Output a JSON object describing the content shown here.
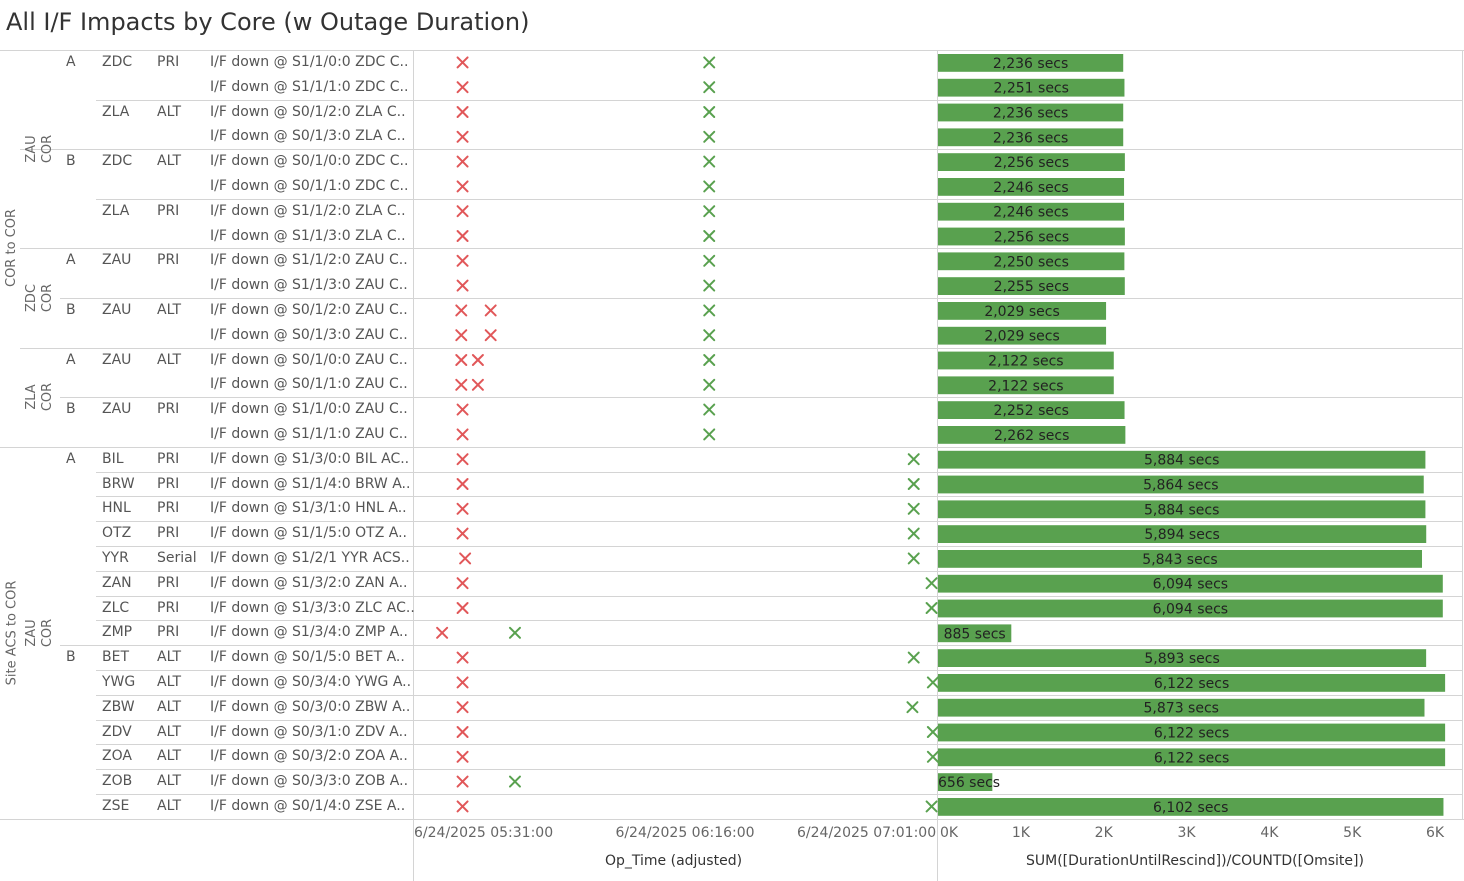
{
  "title": "All I/F Impacts by Core (w Outage Duration)",
  "colors": {
    "down": "#e15759",
    "up": "#59a14f",
    "bar": "#59a14f",
    "grid": "#d4d4d4"
  },
  "icons": {
    "down_mark": "x-mark-icon",
    "up_mark": "x-mark-icon"
  },
  "groups": [
    {
      "label": "COR to COR",
      "cores": [
        {
          "label": [
            "ZAU",
            "COR"
          ],
          "sides": [
            "A",
            "B"
          ]
        },
        {
          "label": [
            "ZDC",
            "COR"
          ],
          "sides": [
            "A",
            "B"
          ]
        },
        {
          "label": [
            "ZLA",
            "COR"
          ],
          "sides": [
            "A",
            "B"
          ]
        }
      ]
    },
    {
      "label": "Site ACS to COR",
      "cores": [
        {
          "label": [
            "ZAU",
            "COR"
          ],
          "sides": [
            "A",
            "B"
          ]
        }
      ]
    }
  ],
  "rows": [
    {
      "side": "A",
      "site": "ZDC",
      "role": "PRI",
      "desc": "I/F down @ S1/1/0:0 ZDC C..",
      "down": [
        "05:32:30"
      ],
      "up": [
        "06:20:45"
      ],
      "duration": 2236,
      "label": "2,236 secs"
    },
    {
      "side": "",
      "site": "",
      "role": "",
      "desc": "I/F down @ S1/1/1:0 ZDC C..",
      "down": [
        "05:32:30"
      ],
      "up": [
        "06:20:45"
      ],
      "duration": 2251,
      "label": "2,251 secs"
    },
    {
      "side": "",
      "site": "ZLA",
      "role": "ALT",
      "desc": "I/F down @ S0/1/2:0 ZLA C..",
      "down": [
        "05:32:30"
      ],
      "up": [
        "06:20:45"
      ],
      "duration": 2236,
      "label": "2,236 secs"
    },
    {
      "side": "",
      "site": "",
      "role": "",
      "desc": "I/F down @ S0/1/3:0 ZLA C..",
      "down": [
        "05:32:30"
      ],
      "up": [
        "06:20:45"
      ],
      "duration": 2236,
      "label": "2,236 secs"
    },
    {
      "side": "B",
      "site": "ZDC",
      "role": "ALT",
      "desc": "I/F down @ S0/1/0:0 ZDC C..",
      "down": [
        "05:32:30"
      ],
      "up": [
        "06:20:45"
      ],
      "duration": 2256,
      "label": "2,256 secs"
    },
    {
      "side": "",
      "site": "",
      "role": "",
      "desc": "I/F down @ S0/1/1:0 ZDC C..",
      "down": [
        "05:32:30"
      ],
      "up": [
        "06:20:45"
      ],
      "duration": 2246,
      "label": "2,246 secs"
    },
    {
      "side": "",
      "site": "ZLA",
      "role": "PRI",
      "desc": "I/F down @ S1/1/2:0 ZLA C..",
      "down": [
        "05:32:30"
      ],
      "up": [
        "06:20:45"
      ],
      "duration": 2246,
      "label": "2,246 secs"
    },
    {
      "side": "",
      "site": "",
      "role": "",
      "desc": "I/F down @ S1/1/3:0 ZLA C..",
      "down": [
        "05:32:30"
      ],
      "up": [
        "06:20:45"
      ],
      "duration": 2256,
      "label": "2,256 secs"
    },
    {
      "side": "A",
      "site": "ZAU",
      "role": "PRI",
      "desc": "I/F down @ S1/1/2:0 ZAU C..",
      "down": [
        "05:32:30"
      ],
      "up": [
        "06:20:45"
      ],
      "duration": 2250,
      "label": "2,250 secs"
    },
    {
      "side": "",
      "site": "",
      "role": "",
      "desc": "I/F down @ S1/1/3:0 ZAU C..",
      "down": [
        "05:32:30"
      ],
      "up": [
        "06:20:45"
      ],
      "duration": 2255,
      "label": "2,255 secs"
    },
    {
      "side": "B",
      "site": "ZAU",
      "role": "ALT",
      "desc": "I/F down @ S0/1/2:0 ZAU C..",
      "down": [
        "05:32:15",
        "05:38:00"
      ],
      "up": [
        "06:20:45"
      ],
      "duration": 2029,
      "label": "2,029 secs"
    },
    {
      "side": "",
      "site": "",
      "role": "",
      "desc": "I/F down @ S0/1/3:0 ZAU C..",
      "down": [
        "05:32:15",
        "05:38:00"
      ],
      "up": [
        "06:20:45"
      ],
      "duration": 2029,
      "label": "2,029 secs"
    },
    {
      "side": "A",
      "site": "ZAU",
      "role": "ALT",
      "desc": "I/F down @ S0/1/0:0 ZAU C..",
      "down": [
        "05:32:15",
        "05:35:30"
      ],
      "up": [
        "06:20:45"
      ],
      "duration": 2122,
      "label": "2,122 secs"
    },
    {
      "side": "",
      "site": "",
      "role": "",
      "desc": "I/F down @ S0/1/1:0 ZAU C..",
      "down": [
        "05:32:15",
        "05:35:30"
      ],
      "up": [
        "06:20:45"
      ],
      "duration": 2122,
      "label": "2,122 secs"
    },
    {
      "side": "B",
      "site": "ZAU",
      "role": "PRI",
      "desc": "I/F down @ S1/1/0:0 ZAU C..",
      "down": [
        "05:32:30"
      ],
      "up": [
        "06:20:45"
      ],
      "duration": 2252,
      "label": "2,252 secs"
    },
    {
      "side": "",
      "site": "",
      "role": "",
      "desc": "I/F down @ S1/1/1:0 ZAU C..",
      "down": [
        "05:32:30"
      ],
      "up": [
        "06:20:45"
      ],
      "duration": 2262,
      "label": "2,262 secs"
    },
    {
      "side": "A",
      "site": "BIL",
      "role": "PRI",
      "desc": "I/F down @ S1/3/0:0 BIL AC..",
      "down": [
        "05:32:30"
      ],
      "up": [
        "07:00:45"
      ],
      "duration": 5884,
      "label": "5,884 secs"
    },
    {
      "side": "",
      "site": "BRW",
      "role": "PRI",
      "desc": "I/F down @ S1/1/4:0 BRW A..",
      "down": [
        "05:32:30"
      ],
      "up": [
        "07:00:45"
      ],
      "duration": 5864,
      "label": "5,864 secs"
    },
    {
      "side": "",
      "site": "HNL",
      "role": "PRI",
      "desc": "I/F down @ S1/3/1:0 HNL A..",
      "down": [
        "05:32:30"
      ],
      "up": [
        "07:00:45"
      ],
      "duration": 5884,
      "label": "5,884 secs"
    },
    {
      "side": "",
      "site": "OTZ",
      "role": "PRI",
      "desc": "I/F down @ S1/1/5:0 OTZ A..",
      "down": [
        "05:32:30"
      ],
      "up": [
        "07:00:45"
      ],
      "duration": 5894,
      "label": "5,894 secs"
    },
    {
      "side": "",
      "site": "YYR",
      "role": "Serial",
      "desc": "I/F down @ S1/2/1 YYR ACS..",
      "down": [
        "05:33:00"
      ],
      "up": [
        "07:00:45"
      ],
      "duration": 5843,
      "label": "5,843 secs"
    },
    {
      "side": "",
      "site": "ZAN",
      "role": "PRI",
      "desc": "I/F down @ S1/3/2:0 ZAN A..",
      "down": [
        "05:32:30"
      ],
      "up": [
        "07:04:15"
      ],
      "duration": 6094,
      "label": "6,094 secs"
    },
    {
      "side": "",
      "site": "ZLC",
      "role": "PRI",
      "desc": "I/F down @ S1/3/3:0 ZLC AC..",
      "down": [
        "05:32:30"
      ],
      "up": [
        "07:04:15"
      ],
      "duration": 6094,
      "label": "6,094 secs"
    },
    {
      "side": "",
      "site": "ZMP",
      "role": "PRI",
      "desc": "I/F down @ S1/3/4:0 ZMP A..",
      "down": [
        "05:28:30"
      ],
      "up": [
        "05:42:45"
      ],
      "duration": 885,
      "label": "885 secs"
    },
    {
      "side": "B",
      "site": "BET",
      "role": "ALT",
      "desc": "I/F down @ S0/1/5:0 BET A..",
      "down": [
        "05:32:30"
      ],
      "up": [
        "07:00:45"
      ],
      "duration": 5893,
      "label": "5,893 secs"
    },
    {
      "side": "",
      "site": "YWG",
      "role": "ALT",
      "desc": "I/F down @ S0/3/4:0 YWG A..",
      "down": [
        "05:32:30"
      ],
      "up": [
        "07:04:30"
      ],
      "duration": 6122,
      "label": "6,122 secs"
    },
    {
      "side": "",
      "site": "ZBW",
      "role": "ALT",
      "desc": "I/F down @ S0/3/0:0 ZBW A..",
      "down": [
        "05:32:30"
      ],
      "up": [
        "07:00:30"
      ],
      "duration": 5873,
      "label": "5,873 secs"
    },
    {
      "side": "",
      "site": "ZDV",
      "role": "ALT",
      "desc": "I/F down @ S0/3/1:0 ZDV A..",
      "down": [
        "05:32:30"
      ],
      "up": [
        "07:04:30"
      ],
      "duration": 6122,
      "label": "6,122 secs"
    },
    {
      "side": "",
      "site": "ZOA",
      "role": "ALT",
      "desc": "I/F down @ S0/3/2:0 ZOA A..",
      "down": [
        "05:32:30"
      ],
      "up": [
        "07:04:30"
      ],
      "duration": 6122,
      "label": "6,122 secs"
    },
    {
      "side": "",
      "site": "ZOB",
      "role": "ALT",
      "desc": "I/F down @ S0/3/3:0 ZOB A..",
      "down": [
        "05:32:30"
      ],
      "up": [
        "05:42:45"
      ],
      "duration": 656,
      "label": "656 secs"
    },
    {
      "side": "",
      "site": "ZSE",
      "role": "ALT",
      "desc": "I/F down @ S0/1/4:0 ZSE A..",
      "down": [
        "05:32:30"
      ],
      "up": [
        "07:04:15"
      ],
      "duration": 6102,
      "label": "6,102 secs"
    }
  ],
  "chart_data": [
    {
      "type": "scatter",
      "xlabel": "Op_Time (adjusted)",
      "xticks": [
        "6/24/2025 05:31:00",
        "6/24/2025 06:16:00",
        "6/24/2025 07:01:00"
      ],
      "xlim": [
        "05:23:00",
        "07:05:30"
      ],
      "series": [
        {
          "name": "",
          "color": "#e15759",
          "field": "down"
        },
        {
          "name": "",
          "color": "#59a14f",
          "field": "up"
        }
      ]
    },
    {
      "type": "bar",
      "orientation": "horizontal",
      "xlabel": "SUM([DurationUntilRescind])/COUNTD([Omsite])",
      "xticks": [
        "0K",
        "1K",
        "2K",
        "3K",
        "4K",
        "5K",
        "6K"
      ],
      "xlim": [
        0,
        6350
      ],
      "values_field": "duration"
    }
  ]
}
